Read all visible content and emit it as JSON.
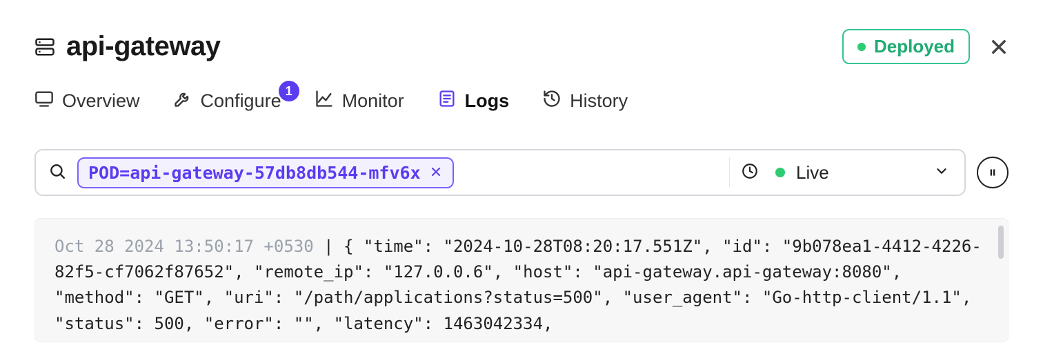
{
  "header": {
    "title": "api-gateway",
    "status_label": "Deployed"
  },
  "tabs": {
    "overview": "Overview",
    "configure": "Configure",
    "configure_badge": "1",
    "monitor": "Monitor",
    "logs": "Logs",
    "history": "History"
  },
  "filter": {
    "chip_text": "POD=api-gateway-57db8db544-mfv6x",
    "live_label": "Live"
  },
  "log": {
    "timestamp": "Oct 28 2024 13:50:17 +0530",
    "body": " | { \"time\": \"2024-10-28T08:20:17.551Z\", \"id\": \"9b078ea1-4412-4226-82f5-cf7062f87652\", \"remote_ip\": \"127.0.0.6\", \"host\": \"api-gateway.api-gateway:8080\", \"method\": \"GET\", \"uri\": \"/path/applications?status=500\", \"user_agent\": \"Go-http-client/1.1\", \"status\": 500, \"error\": \"\", \"latency\": 1463042334,"
  }
}
